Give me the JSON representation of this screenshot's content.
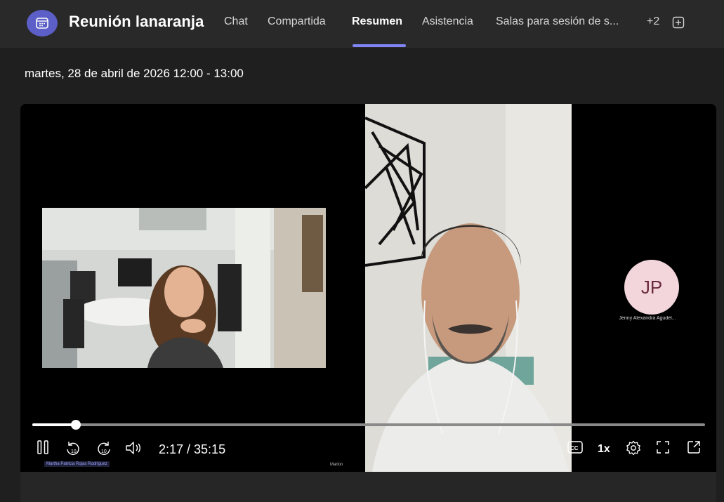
{
  "header": {
    "title": "Reunión lanaranja",
    "tabs": [
      {
        "label": "Chat"
      },
      {
        "label": "Compartida"
      },
      {
        "label": "Resumen"
      },
      {
        "label": "Asistencia"
      },
      {
        "label": "Salas para sesión de s..."
      }
    ],
    "active_tab": "Resumen",
    "more_count": "+2",
    "accent_color": "#7f85f5",
    "calendar_icon_bg": "#5b5fc7"
  },
  "meeting": {
    "date_time": "martes, 28 de abril de 2026 12:00 - 13:00"
  },
  "video": {
    "participants": [
      {
        "name": "Martha Patricia Rojas Rodríguez"
      },
      {
        "name": "Marlon"
      },
      {
        "name": "Jenny Alexandra Agudel...",
        "initials": "JP",
        "avatar_color": "#f3d6dc"
      }
    ],
    "time": "2:17 / 35:15",
    "progress": 0.065,
    "speed": "1x"
  },
  "icons": {
    "calendar": "calendar-icon",
    "add_tab": "add-tab-icon",
    "pause": "pause-icon",
    "rewind": "rewind-10-icon",
    "forward": "forward-10-icon",
    "volume": "volume-icon",
    "captions": "captions-icon",
    "settings": "settings-icon",
    "fullscreen": "fullscreen-icon",
    "popout": "popout-icon"
  }
}
